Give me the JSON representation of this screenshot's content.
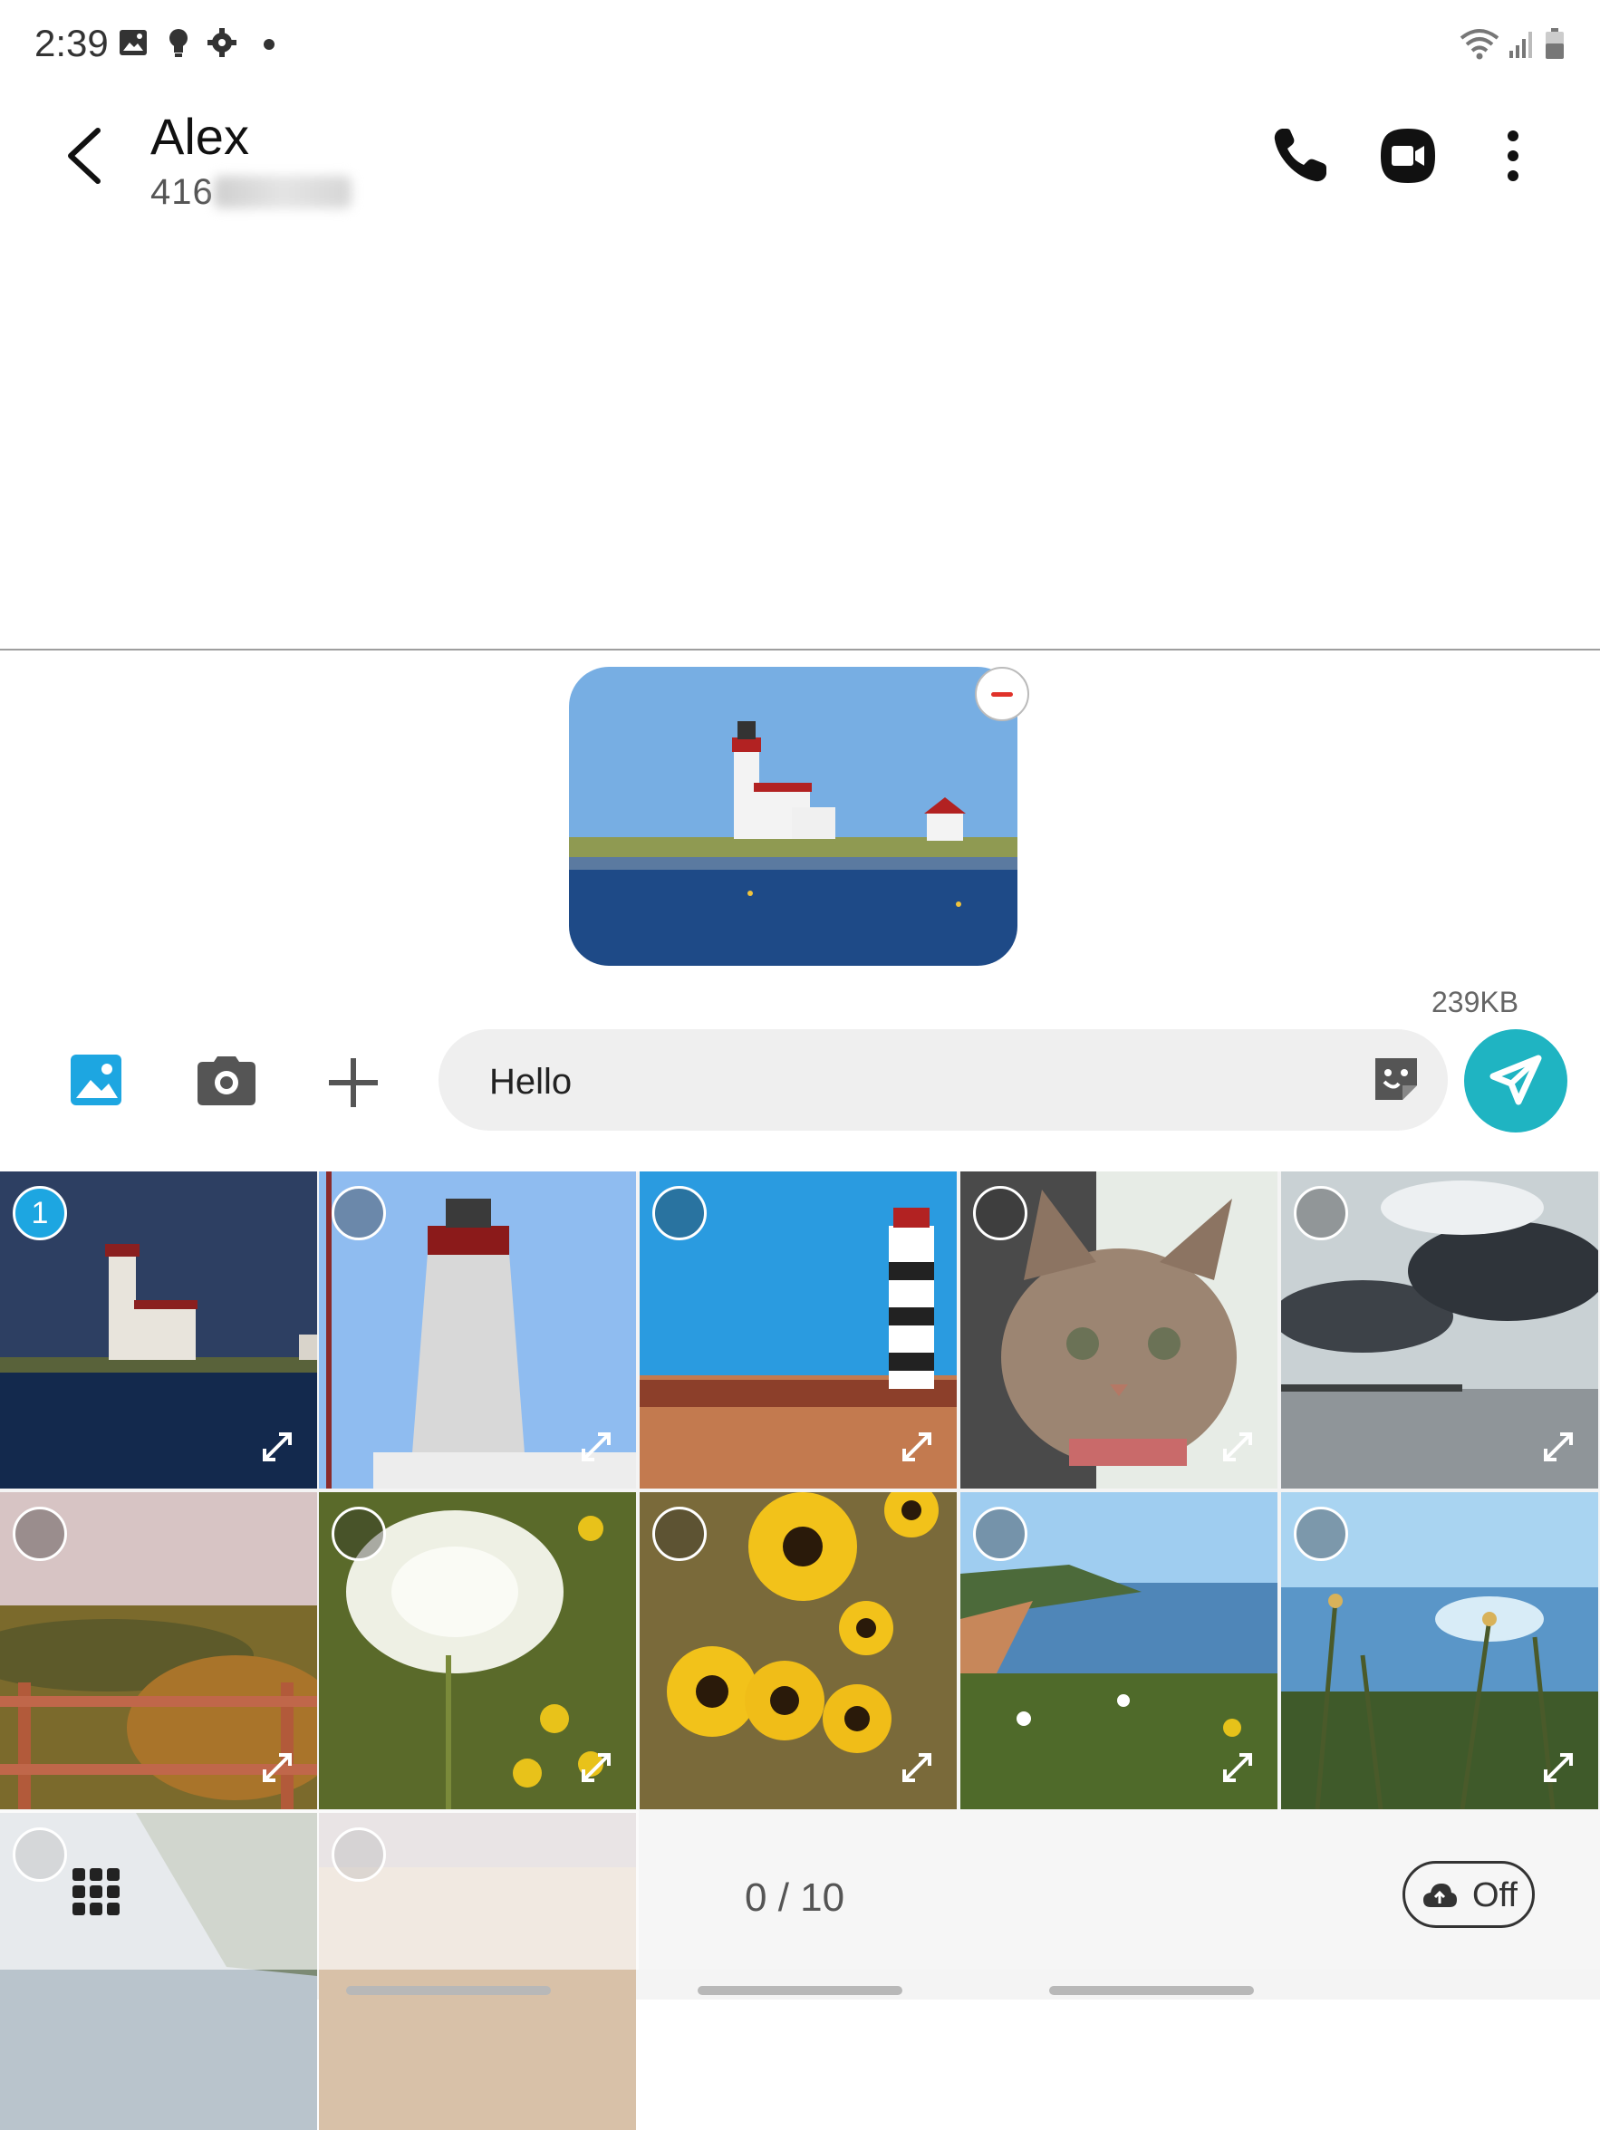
{
  "status_bar": {
    "time": "2:39"
  },
  "conversation": {
    "contact_name": "Alex",
    "phone_prefix": "416"
  },
  "attachment": {
    "size": "239KB"
  },
  "composer": {
    "text": "Hello"
  },
  "gallery": {
    "selected_number": "1",
    "selection_count": "0 / 10",
    "cloud_toggle_label": "Off"
  },
  "colors": {
    "accent": "#1da6e1",
    "send": "#1fb4c2",
    "remove": "#e0322a"
  }
}
